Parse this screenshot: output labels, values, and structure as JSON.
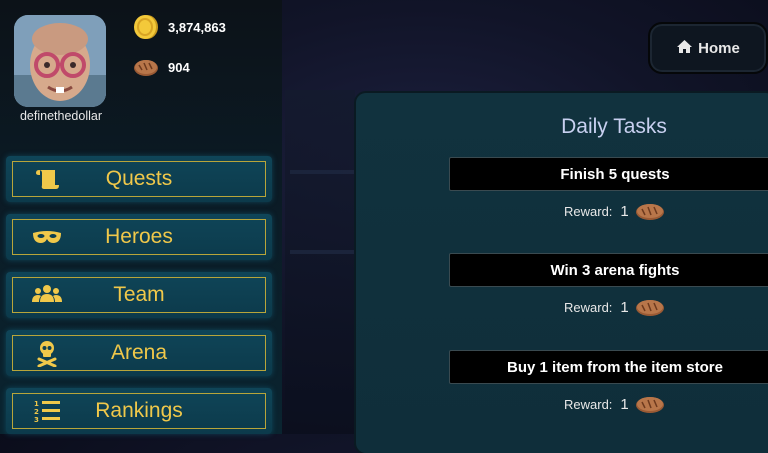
{
  "player": {
    "username": "definethedollar",
    "coins": "3,874,863",
    "bread": "904"
  },
  "home_button": {
    "label": "Home",
    "icon": "home-icon"
  },
  "nav": [
    {
      "label": "Quests",
      "icon": "scroll-icon"
    },
    {
      "label": "Heroes",
      "icon": "mask-icon"
    },
    {
      "label": "Team",
      "icon": "group-icon"
    },
    {
      "label": "Arena",
      "icon": "skull-crossbones-icon"
    },
    {
      "label": "Rankings",
      "icon": "ordered-list-icon"
    }
  ],
  "daily_tasks": {
    "title": "Daily Tasks",
    "tasks": [
      {
        "name": "Finish 5 quests",
        "reward_label": "Reward:",
        "reward_amount": "1",
        "reward_icon": "bread-icon"
      },
      {
        "name": "Win 3 arena fights",
        "reward_label": "Reward:",
        "reward_amount": "1",
        "reward_icon": "bread-icon"
      },
      {
        "name": "Buy 1 item from the item store",
        "reward_label": "Reward:",
        "reward_amount": "1",
        "reward_icon": "bread-icon"
      }
    ]
  },
  "colors": {
    "accent_gold": "#f0c84a",
    "nav_border": "#b8a53a",
    "panel_teal": "#11323e"
  }
}
